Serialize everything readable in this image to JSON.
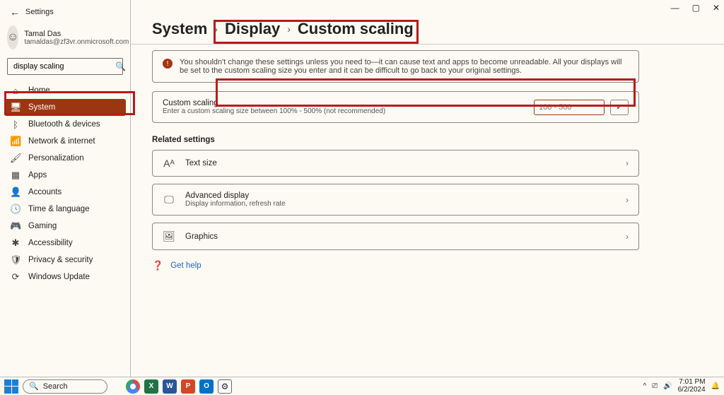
{
  "window": {
    "title": "Settings",
    "min": "—",
    "max": "▢",
    "close": "✕"
  },
  "user": {
    "name": "Tamal Das",
    "email": "tamaldas@zf3vr.onmicrosoft.com"
  },
  "search": {
    "value": "display scaling",
    "icon": "🔍"
  },
  "nav": [
    {
      "icon": "⌂",
      "label": "Home"
    },
    {
      "icon": "🖥",
      "label": "System",
      "active": true
    },
    {
      "icon": "ᛒ",
      "label": "Bluetooth & devices"
    },
    {
      "icon": "📶",
      "label": "Network & internet"
    },
    {
      "icon": "🖌",
      "label": "Personalization"
    },
    {
      "icon": "▦",
      "label": "Apps"
    },
    {
      "icon": "👤",
      "label": "Accounts"
    },
    {
      "icon": "🕓",
      "label": "Time & language"
    },
    {
      "icon": "🎮",
      "label": "Gaming"
    },
    {
      "icon": "✱",
      "label": "Accessibility"
    },
    {
      "icon": "🛡",
      "label": "Privacy & security"
    },
    {
      "icon": "⟳",
      "label": "Windows Update"
    }
  ],
  "breadcrumb": [
    "System",
    "Display",
    "Custom scaling"
  ],
  "warning": "You shouldn't change these settings unless you need to—it can cause text and apps to become unreadable. All your displays will be set to the custom scaling size you enter and it can be difficult to go back to your original settings.",
  "scaling": {
    "title": "Custom scaling",
    "sub": "Enter a custom scaling size between 100% - 500% (not recommended)",
    "placeholder": "100 - 500",
    "apply": "✓"
  },
  "related": {
    "heading": "Related settings",
    "items": [
      {
        "icon": "Aᴬ",
        "title": "Text size",
        "sub": ""
      },
      {
        "icon": "🖵",
        "title": "Advanced display",
        "sub": "Display information, refresh rate"
      },
      {
        "icon": "🖼",
        "title": "Graphics",
        "sub": ""
      }
    ]
  },
  "help": {
    "icon": "❓",
    "label": "Get help"
  },
  "taskbar": {
    "search": "Search",
    "time": "7:01 PM",
    "date": "6/2/2024",
    "tray": [
      "^",
      "⎚",
      "🔊"
    ]
  }
}
